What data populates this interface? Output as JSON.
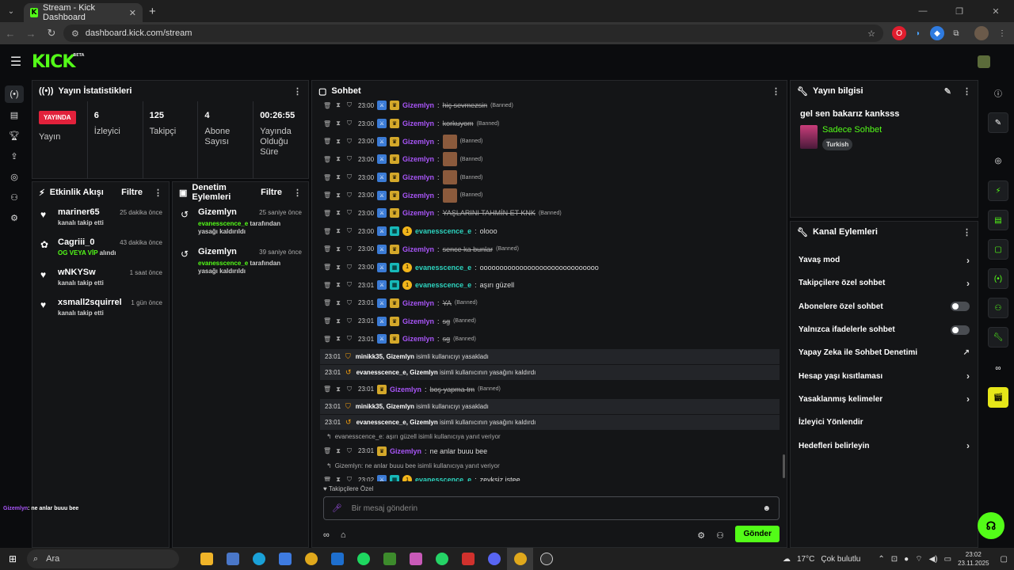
{
  "browser": {
    "tab_title": "Stream - Kick Dashboard",
    "url": "dashboard.kick.com/stream"
  },
  "site": {
    "logo": "KICK",
    "beta": "BETA"
  },
  "stats_panel": {
    "title": "Yayın İstatistikleri",
    "live_badge": "YAYINDA",
    "items": [
      {
        "label": "Yayın",
        "value": ""
      },
      {
        "value": "6",
        "label": "İzleyici"
      },
      {
        "value": "125",
        "label": "Takipçi"
      },
      {
        "value": "4",
        "label": "Abone Sayısı"
      },
      {
        "value": "00:26:55",
        "label": "Yayında Olduğu Süre"
      }
    ]
  },
  "activity": {
    "title": "Etkinlik Akışı",
    "filter": "Filtre",
    "events": [
      {
        "icon": "heart-icon",
        "name": "mariner65",
        "sub": "kanalı takip etti",
        "time": "25 dakika önce"
      },
      {
        "icon": "gift-icon",
        "name": "Cagriii_0",
        "sub": "OG VEYA VİP",
        "sub2": "alındı",
        "time": "43 dakika önce"
      },
      {
        "icon": "heart-icon",
        "name": "wNKYSw",
        "sub": "kanalı takip etti",
        "time": "1 saat önce"
      },
      {
        "icon": "heart-icon",
        "name": "xsmall2squirrel",
        "sub": "kanalı takip etti",
        "time": "1 gün önce"
      }
    ]
  },
  "moderation": {
    "title": "Denetim Eylemleri",
    "filter": "Filtre",
    "events": [
      {
        "name": "Gizemlyn",
        "target": "evanesscence_e",
        "text": "tarafından yasağı kaldırıldı",
        "time": "25 saniye önce"
      },
      {
        "name": "Gizemlyn",
        "target": "evanesscence_e",
        "text": "tarafından yasağı kaldırıldı",
        "time": "39 saniye önce"
      }
    ]
  },
  "chat": {
    "title": "Sohbet",
    "messages": [
      {
        "type": "msg",
        "time": "23:00",
        "user": "Gizemlyn",
        "color": "purple",
        "badges": [
          "mod",
          "crown"
        ],
        "text": "hiç sevmezsin",
        "strike": true,
        "banned": "(Banned)"
      },
      {
        "type": "msg",
        "time": "23:00",
        "user": "Gizemlyn",
        "color": "purple",
        "badges": [
          "mod",
          "crown"
        ],
        "text": "korkuyom",
        "strike": true,
        "banned": "(Banned)"
      },
      {
        "type": "msg",
        "time": "23:00",
        "user": "Gizemlyn",
        "color": "purple",
        "badges": [
          "mod",
          "crown"
        ],
        "emote": true,
        "banned": "(Banned)"
      },
      {
        "type": "msg",
        "time": "23:00",
        "user": "Gizemlyn",
        "color": "purple",
        "badges": [
          "mod",
          "crown"
        ],
        "emote": true,
        "banned": "(Banned)"
      },
      {
        "type": "msg",
        "time": "23:00",
        "user": "Gizemlyn",
        "color": "purple",
        "badges": [
          "mod",
          "crown"
        ],
        "emote": true,
        "banned": "(Banned)"
      },
      {
        "type": "msg",
        "time": "23:00",
        "user": "Gizemlyn",
        "color": "purple",
        "badges": [
          "mod",
          "crown"
        ],
        "emote": true,
        "banned": "(Banned)"
      },
      {
        "type": "msg",
        "time": "23:00",
        "user": "Gizemlyn",
        "color": "purple",
        "badges": [
          "mod",
          "crown"
        ],
        "text": "YAŞLARINI TAHMİN ET KNK",
        "strike": true,
        "banned": "(Banned)"
      },
      {
        "type": "msg",
        "time": "23:00",
        "user": "evanesscence_e",
        "color": "teal",
        "badges": [
          "mod",
          "gift",
          "coin"
        ],
        "text": "olooo"
      },
      {
        "type": "msg",
        "time": "23:00",
        "user": "Gizemlyn",
        "color": "purple",
        "badges": [
          "mod",
          "crown"
        ],
        "text": "sence ka bunlar",
        "strike": true,
        "banned": "(Banned)"
      },
      {
        "type": "msg",
        "time": "23:00",
        "user": "evanesscence_e",
        "color": "teal",
        "badges": [
          "mod",
          "gift",
          "coin"
        ],
        "text": "oooooooooooooooooooooooooooooo"
      },
      {
        "type": "msg",
        "time": "23:01",
        "user": "evanesscence_e",
        "color": "teal",
        "badges": [
          "mod",
          "gift",
          "coin"
        ],
        "text": "aşırı güzell"
      },
      {
        "type": "msg",
        "time": "23:01",
        "user": "Gizemlyn",
        "color": "purple",
        "badges": [
          "mod",
          "crown"
        ],
        "text": "YA",
        "strike": true,
        "banned": "(Banned)"
      },
      {
        "type": "msg",
        "time": "23:01",
        "user": "Gizemlyn",
        "color": "purple",
        "badges": [
          "mod",
          "crown"
        ],
        "text": "sg",
        "strike": true,
        "banned": "(Banned)"
      },
      {
        "type": "msg",
        "time": "23:01",
        "user": "Gizemlyn",
        "color": "purple",
        "badges": [
          "mod",
          "crown"
        ],
        "text": "sg",
        "strike": true,
        "banned": "(Banned)"
      },
      {
        "type": "sys",
        "time": "23:01",
        "icon": "ban",
        "names": "minikk35, Gizemlyn",
        "text": "isimli kullanıcıyı yasakladı"
      },
      {
        "type": "sys",
        "time": "23:01",
        "icon": "unban",
        "names": "evanesscence_e, Gizemlyn",
        "text": "isimli kullanıcının yasağını kaldırdı"
      },
      {
        "type": "msg",
        "time": "23:01",
        "user": "Gizemlyn",
        "color": "purple",
        "badges": [
          "crown"
        ],
        "text": "boş yapma tm",
        "strike": true,
        "banned": "(Banned)"
      },
      {
        "type": "sys",
        "time": "23:01",
        "icon": "ban",
        "names": "minikk35, Gizemlyn",
        "text": "isimli kullanıcıyı yasakladı"
      },
      {
        "type": "sys",
        "time": "23:01",
        "icon": "unban",
        "names": "evanesscence_e, Gizemlyn",
        "text": "isimli kullanıcının yasağını kaldırdı"
      },
      {
        "type": "reply",
        "text": "evanesscence_e: aşırı güzell isimli kullanıcıya yanıt veriyor"
      },
      {
        "type": "msg",
        "time": "23:01",
        "user": "Gizemlyn",
        "color": "purple",
        "badges": [
          "crown"
        ],
        "text": "ne anlar buuu bee"
      },
      {
        "type": "reply",
        "text": "Gizemlyn: ne anlar buuu bee isimli kullanıcıya yanıt veriyor"
      },
      {
        "type": "msg",
        "time": "23:02",
        "user": "evanesscence_e",
        "color": "teal",
        "badges": [
          "mod",
          "gift",
          "coin"
        ],
        "text": "zevksiz iştee"
      }
    ],
    "follow_only": "Takipçilere Özel",
    "input_placeholder": "Bir mesaj gönderin",
    "send_label": "Gönder"
  },
  "stream_info": {
    "title": "Yayın bilgisi",
    "stream_title": "gel sen bakarız kanksss",
    "category": "Sadece Sohbet",
    "tag": "Turkish"
  },
  "channel_actions": {
    "title": "Kanal Eylemleri",
    "items": [
      {
        "label": "Yavaş mod",
        "control": "arrow"
      },
      {
        "label": "Takipçilere özel sohbet",
        "control": "arrow"
      },
      {
        "label": "Abonelere özel sohbet",
        "control": "toggle"
      },
      {
        "label": "Yalnızca ifadelerle sohbet",
        "control": "toggle"
      },
      {
        "label": "Yapay Zeka ile Sohbet Denetimi",
        "control": "external"
      },
      {
        "label": "Hesap yaşı kısıtlaması",
        "control": "arrow"
      },
      {
        "label": "Yasaklanmış kelimeler",
        "control": "arrow"
      },
      {
        "label": "İzleyici Yönlendir",
        "control": "none"
      },
      {
        "label": "Hedefleri belirleyin",
        "control": "arrow"
      }
    ]
  },
  "overlay": {
    "user": "Gizemlyn",
    "text": ": ne anlar buuu bee"
  },
  "taskbar": {
    "search": "Ara",
    "weather_temp": "17°C",
    "weather_text": "Çok bulutlu",
    "time": "23:02",
    "date": "23.11.2025"
  },
  "colors": {
    "accent": "#53fc18",
    "live": "#e2213b",
    "purple_user": "#a855f7",
    "teal_user": "#2dd4bf"
  }
}
